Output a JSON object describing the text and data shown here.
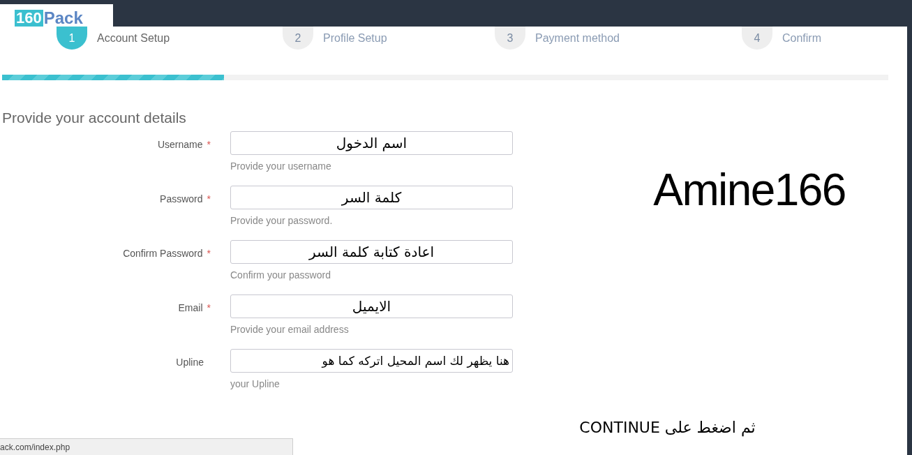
{
  "logo": {
    "number": "160",
    "word": "Pack"
  },
  "steps": [
    {
      "number": "1",
      "label": "Account Setup",
      "selected": true
    },
    {
      "number": "2",
      "label": "Profile Setup",
      "selected": false
    },
    {
      "number": "3",
      "label": "Payment method",
      "selected": false
    },
    {
      "number": "4",
      "label": "Confirm",
      "selected": false
    }
  ],
  "progress": {
    "level": 0.25
  },
  "heading": "Provide your account details",
  "fields": [
    {
      "label": "Username",
      "required": true,
      "value": "اسم الدخول",
      "help": "Provide your username"
    },
    {
      "label": "Password",
      "required": true,
      "value": "كلمة السر",
      "help": "Provide your password."
    },
    {
      "label": "Confirm Password",
      "required": true,
      "value": "اعادة كتابة كلمة السر",
      "help": "Confirm your password"
    },
    {
      "label": "Email",
      "required": true,
      "value": "الايميل",
      "help": "Provide your email address"
    },
    {
      "label": "Upline",
      "required": false,
      "value": "هنا يظهر لك اسم المحيل اتركه كما هو",
      "help": "your Upline"
    }
  ],
  "required_mark": "*",
  "annotation": "Amine166",
  "instruction": "ثم اضغط على CONTINUE",
  "status_url": "ack.com/index.php"
}
